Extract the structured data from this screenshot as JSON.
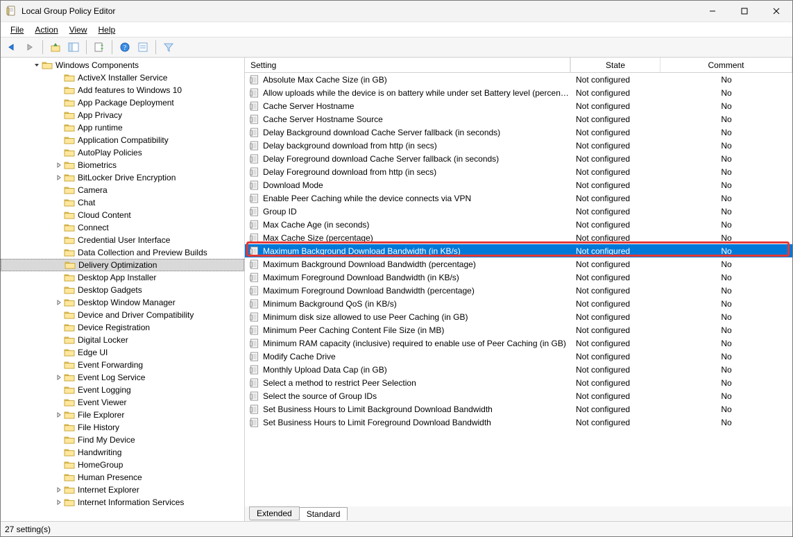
{
  "window": {
    "title": "Local Group Policy Editor"
  },
  "menu": {
    "file": "File",
    "action": "Action",
    "view": "View",
    "help": "Help"
  },
  "tree": {
    "root": {
      "label": "Windows Components",
      "indent": 46,
      "chevron": "down"
    },
    "items": [
      {
        "label": "ActiveX Installer Service",
        "indent": 78
      },
      {
        "label": "Add features to Windows 10",
        "indent": 78
      },
      {
        "label": "App Package Deployment",
        "indent": 78
      },
      {
        "label": "App Privacy",
        "indent": 78
      },
      {
        "label": "App runtime",
        "indent": 78
      },
      {
        "label": "Application Compatibility",
        "indent": 78
      },
      {
        "label": "AutoPlay Policies",
        "indent": 78
      },
      {
        "label": "Biometrics",
        "indent": 78,
        "chevron": "right"
      },
      {
        "label": "BitLocker Drive Encryption",
        "indent": 78,
        "chevron": "right"
      },
      {
        "label": "Camera",
        "indent": 78
      },
      {
        "label": "Chat",
        "indent": 78
      },
      {
        "label": "Cloud Content",
        "indent": 78
      },
      {
        "label": "Connect",
        "indent": 78
      },
      {
        "label": "Credential User Interface",
        "indent": 78
      },
      {
        "label": "Data Collection and Preview Builds",
        "indent": 78
      },
      {
        "label": "Delivery Optimization",
        "indent": 78,
        "selected": true
      },
      {
        "label": "Desktop App Installer",
        "indent": 78
      },
      {
        "label": "Desktop Gadgets",
        "indent": 78
      },
      {
        "label": "Desktop Window Manager",
        "indent": 78,
        "chevron": "right"
      },
      {
        "label": "Device and Driver Compatibility",
        "indent": 78
      },
      {
        "label": "Device Registration",
        "indent": 78
      },
      {
        "label": "Digital Locker",
        "indent": 78
      },
      {
        "label": "Edge UI",
        "indent": 78
      },
      {
        "label": "Event Forwarding",
        "indent": 78
      },
      {
        "label": "Event Log Service",
        "indent": 78,
        "chevron": "right"
      },
      {
        "label": "Event Logging",
        "indent": 78
      },
      {
        "label": "Event Viewer",
        "indent": 78
      },
      {
        "label": "File Explorer",
        "indent": 78,
        "chevron": "right"
      },
      {
        "label": "File History",
        "indent": 78
      },
      {
        "label": "Find My Device",
        "indent": 78
      },
      {
        "label": "Handwriting",
        "indent": 78
      },
      {
        "label": "HomeGroup",
        "indent": 78
      },
      {
        "label": "Human Presence",
        "indent": 78
      },
      {
        "label": "Internet Explorer",
        "indent": 78,
        "chevron": "right"
      },
      {
        "label": "Internet Information Services",
        "indent": 78,
        "chevron": "right"
      }
    ]
  },
  "list": {
    "headers": {
      "setting": "Setting",
      "state": "State",
      "comment": "Comment"
    },
    "rows": [
      {
        "setting": "Absolute Max Cache Size (in GB)",
        "state": "Not configured",
        "comment": "No"
      },
      {
        "setting": "Allow uploads while the device is on battery while under set Battery level (percentage)",
        "state": "Not configured",
        "comment": "No"
      },
      {
        "setting": "Cache Server Hostname",
        "state": "Not configured",
        "comment": "No"
      },
      {
        "setting": "Cache Server Hostname Source",
        "state": "Not configured",
        "comment": "No"
      },
      {
        "setting": "Delay Background download Cache Server fallback (in seconds)",
        "state": "Not configured",
        "comment": "No"
      },
      {
        "setting": "Delay background download from http (in secs)",
        "state": "Not configured",
        "comment": "No"
      },
      {
        "setting": "Delay Foreground download Cache Server fallback (in seconds)",
        "state": "Not configured",
        "comment": "No"
      },
      {
        "setting": "Delay Foreground download from http (in secs)",
        "state": "Not configured",
        "comment": "No"
      },
      {
        "setting": "Download Mode",
        "state": "Not configured",
        "comment": "No"
      },
      {
        "setting": "Enable Peer Caching while the device connects via VPN",
        "state": "Not configured",
        "comment": "No"
      },
      {
        "setting": "Group ID",
        "state": "Not configured",
        "comment": "No"
      },
      {
        "setting": "Max Cache Age (in seconds)",
        "state": "Not configured",
        "comment": "No"
      },
      {
        "setting": "Max Cache Size (percentage)",
        "state": "Not configured",
        "comment": "No"
      },
      {
        "setting": "Maximum Background Download Bandwidth (in KB/s)",
        "state": "Not configured",
        "comment": "No",
        "selected": true,
        "highlight": true
      },
      {
        "setting": "Maximum Background Download Bandwidth (percentage)",
        "state": "Not configured",
        "comment": "No"
      },
      {
        "setting": "Maximum Foreground Download Bandwidth (in KB/s)",
        "state": "Not configured",
        "comment": "No"
      },
      {
        "setting": "Maximum Foreground Download Bandwidth (percentage)",
        "state": "Not configured",
        "comment": "No"
      },
      {
        "setting": "Minimum Background QoS (in KB/s)",
        "state": "Not configured",
        "comment": "No"
      },
      {
        "setting": "Minimum disk size allowed to use Peer Caching (in GB)",
        "state": "Not configured",
        "comment": "No"
      },
      {
        "setting": "Minimum Peer Caching Content File Size (in MB)",
        "state": "Not configured",
        "comment": "No"
      },
      {
        "setting": "Minimum RAM capacity (inclusive) required to enable use of Peer Caching (in GB)",
        "state": "Not configured",
        "comment": "No"
      },
      {
        "setting": "Modify Cache Drive",
        "state": "Not configured",
        "comment": "No"
      },
      {
        "setting": "Monthly Upload Data Cap (in GB)",
        "state": "Not configured",
        "comment": "No"
      },
      {
        "setting": "Select a method to restrict Peer Selection",
        "state": "Not configured",
        "comment": "No"
      },
      {
        "setting": "Select the source of Group IDs",
        "state": "Not configured",
        "comment": "No"
      },
      {
        "setting": "Set Business Hours to Limit Background Download Bandwidth",
        "state": "Not configured",
        "comment": "No"
      },
      {
        "setting": "Set Business Hours to Limit Foreground Download Bandwidth",
        "state": "Not configured",
        "comment": "No"
      }
    ]
  },
  "tabs": {
    "extended": "Extended",
    "standard": "Standard"
  },
  "status": {
    "text": "27 setting(s)"
  }
}
